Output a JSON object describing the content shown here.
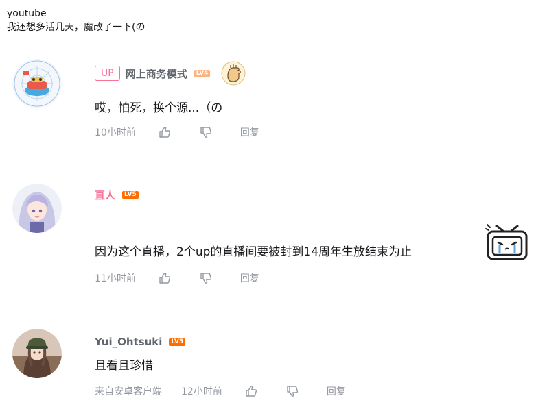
{
  "quoted_post": {
    "line1": "youtube",
    "line2": "我还想多活几天，魔改了一下(の"
  },
  "comments": [
    {
      "up_badge": "UP",
      "username": "网上商务模式",
      "level": "LV4",
      "text": "哎，怕死，换个源...（の",
      "time": "10小时前",
      "reply_label": "回复"
    },
    {
      "username": "直人",
      "level": "LV5",
      "text": "因为这个直播，2个up的直播间要被封到14周年生放结束为止",
      "time": "11小时前",
      "reply_label": "回复"
    },
    {
      "username": "Yui_Ohtsuki",
      "level": "LV5",
      "text": "且看且珍惜",
      "source": "来自安卓客户端",
      "time": "12小时前",
      "reply_label": "回复"
    }
  ],
  "icons": {
    "like": "thumbs-up-icon",
    "dislike": "thumbs-down-icon",
    "sticker": "bilibili-tv-crying-sticker",
    "medal": "fist-emoji-icon"
  },
  "colors": {
    "pink": "#fb7299",
    "lv5": "#ff6c00",
    "lv4": "#ffb37c",
    "meta_gray": "#9499a0",
    "divider": "#e3e5e7"
  }
}
